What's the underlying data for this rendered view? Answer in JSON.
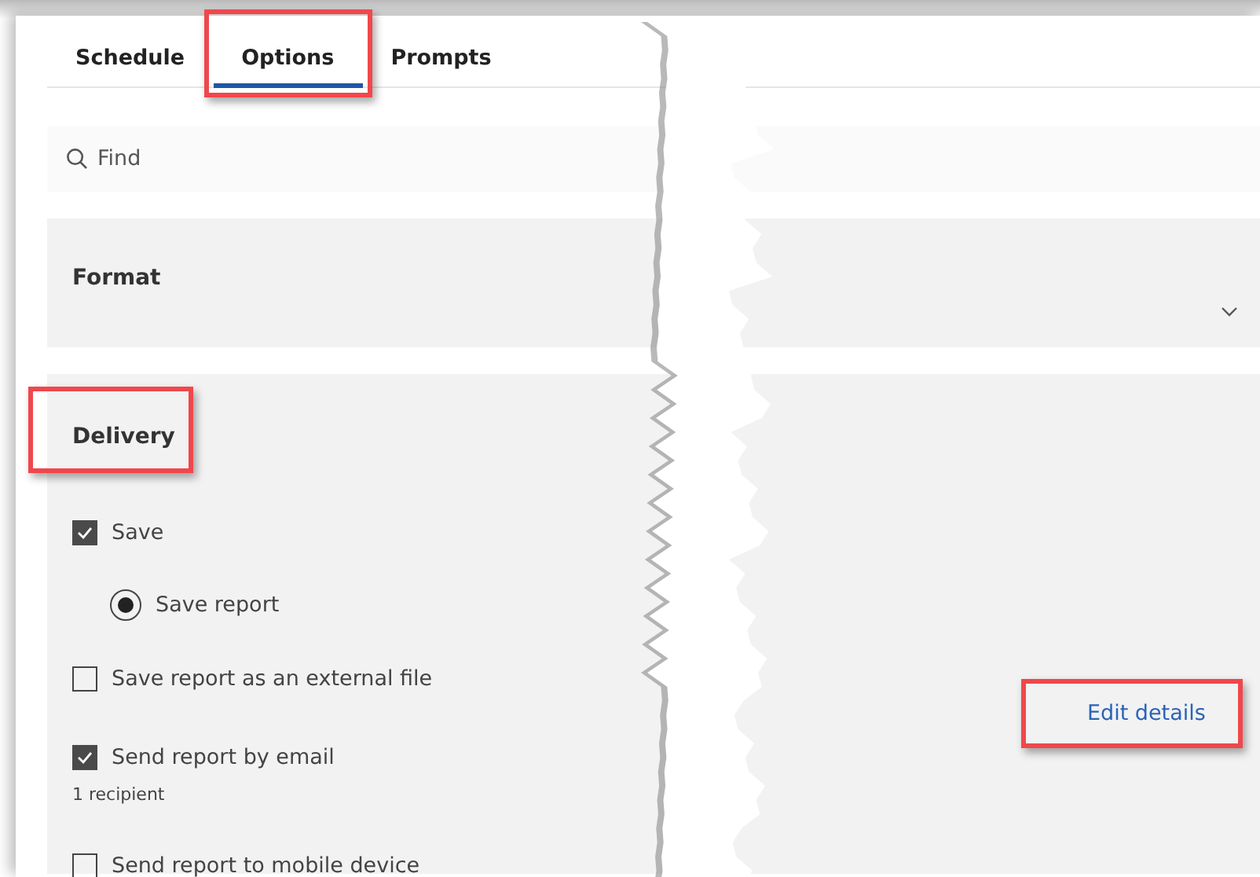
{
  "tabs": [
    {
      "label": "Schedule",
      "selected": false,
      "highlighted": false
    },
    {
      "label": "Options",
      "selected": true,
      "highlighted": true
    },
    {
      "label": "Prompts",
      "selected": false,
      "highlighted": false
    }
  ],
  "search": {
    "placeholder": "Find"
  },
  "sections": [
    {
      "title": "Format",
      "expanded": false,
      "highlighted": false
    },
    {
      "title": "Delivery",
      "expanded": true,
      "highlighted": true,
      "options": [
        {
          "kind": "checkbox",
          "label": "Save",
          "checked": true
        },
        {
          "kind": "radio",
          "label": "Save report",
          "checked": true
        },
        {
          "kind": "checkbox",
          "label": "Save report as an external file",
          "checked": false
        },
        {
          "kind": "checkbox",
          "label": "Send report by email",
          "checked": true,
          "note": "1 recipient",
          "link": {
            "label": "Edit details",
            "highlighted": true
          }
        },
        {
          "kind": "checkbox",
          "label": "Send report to mobile device",
          "checked": false
        }
      ]
    }
  ]
}
